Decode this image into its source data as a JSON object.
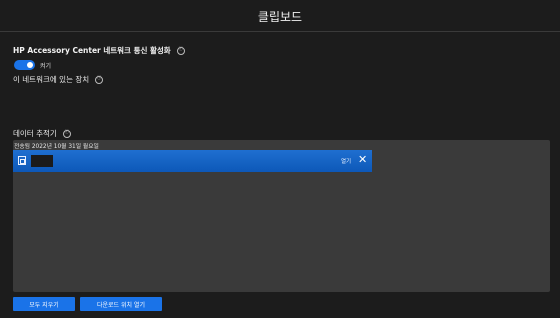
{
  "app": {
    "title": "클립보드"
  },
  "network_sharing": {
    "label": "HP Accessory Center 네트워크 통신 활성화",
    "toggle_state": "켜기",
    "toggle_on": true
  },
  "devices_on_network": {
    "label": "이 네트워크에 있는 장치"
  },
  "data_tracker": {
    "label": "데이터 추적기",
    "date_header": "전송됨 2022년 10월 31일 월요일",
    "items": [
      {
        "open_label": "열기",
        "close_glyph": "✕"
      }
    ]
  },
  "footer": {
    "clear_all": "모두 지우기",
    "open_download_location": "다운로드 위치 열기"
  },
  "icons": {
    "info": "ⓘ"
  },
  "colors": {
    "accent": "#1a73e8",
    "background": "#1c1c1c",
    "panel": "#3a3a3a"
  }
}
